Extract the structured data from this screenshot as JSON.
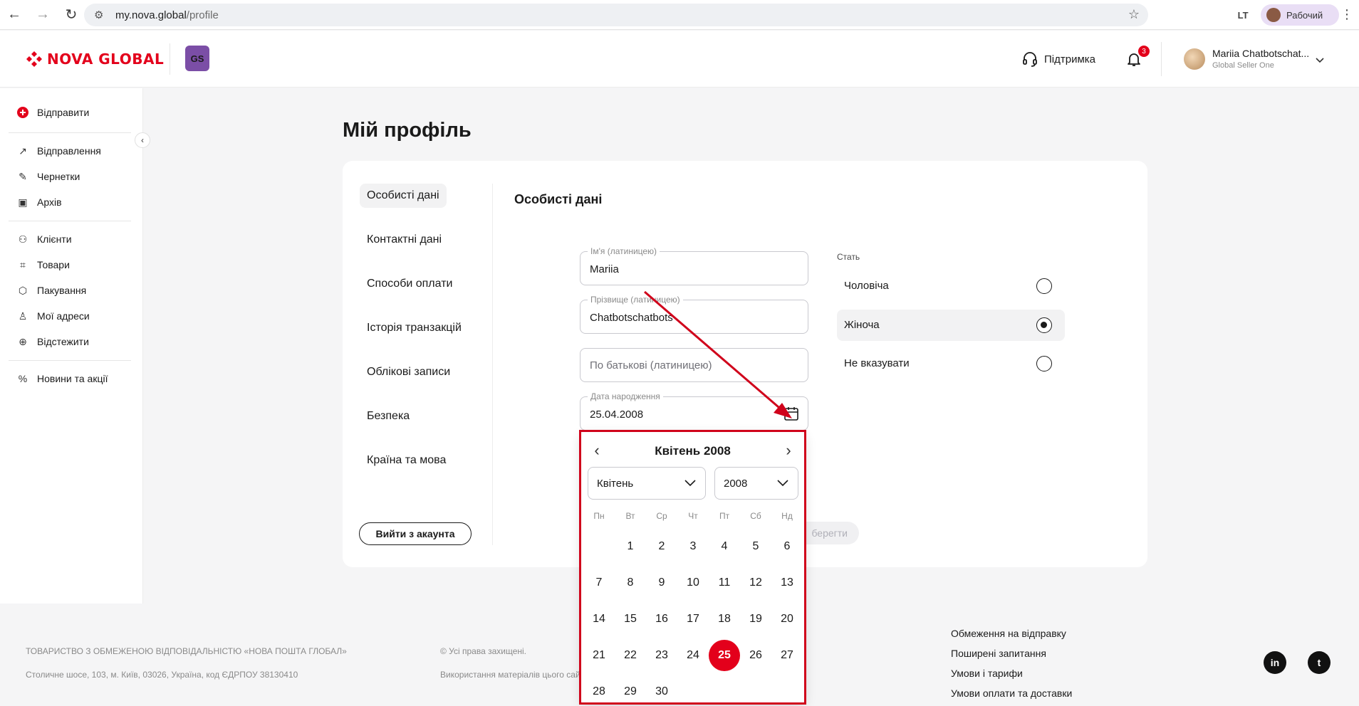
{
  "browser": {
    "url_host": "my.nova.global",
    "url_path": "/profile",
    "profile_label": "Рабочий"
  },
  "header": {
    "logo_text": "NOVA GLOBAL",
    "gs_badge": "GS",
    "support_label": "Підтримка",
    "notification_count": "3",
    "user_name": "Mariia Chatbotschat...",
    "user_org": "Global Seller One"
  },
  "sidebar": {
    "send_label": "Відправити",
    "group1": [
      "Відправлення",
      "Чернетки",
      "Архів"
    ],
    "group2": [
      "Клієнти",
      "Товари",
      "Пакування",
      "Мої адреси",
      "Відстежити"
    ],
    "group3": [
      "Новини та акції"
    ]
  },
  "main": {
    "page_title": "Мій профіль",
    "subnav": [
      "Особисті дані",
      "Контактні дані",
      "Способи оплати",
      "Історія транзакцій",
      "Облікові записи",
      "Безпека",
      "Країна та мова"
    ],
    "logout_label": "Вийти з акаунта",
    "section_title": "Особисті дані",
    "first_name": {
      "label": "Ім'я (латиницею)",
      "value": "Mariia"
    },
    "last_name": {
      "label": "Прізвище (латиницею)",
      "value": "Chatbotschatbots"
    },
    "patronymic": {
      "placeholder": "По батькові (латиницею)"
    },
    "birth_date": {
      "label": "Дата народження",
      "value": "25.04.2008"
    },
    "gender_label": "Стать",
    "gender_options": [
      "Чоловіча",
      "Жіноча",
      "Не вказувати"
    ],
    "gender_selected_index": 1,
    "save_label": "берегти"
  },
  "calendar": {
    "title": "Квітень 2008",
    "month_select": "Квітень",
    "year_select": "2008",
    "weekdays": [
      "Пн",
      "Вт",
      "Ср",
      "Чт",
      "Пт",
      "Сб",
      "Нд"
    ],
    "first_weekday_offset": 1,
    "days_in_month": 30,
    "selected_day": 25
  },
  "footer": {
    "company": "ТОВАРИСТВО З ОБМЕЖЕНОЮ ВІДПОВІДАЛЬНІСТЮ «НОВА ПОШТА ГЛОБАЛ»",
    "address": "Столичне шосе, 103, м. Київ, 03026, Україна, код ЄДРПОУ 38130410",
    "rights": "© Усі права захищені.",
    "usage": "Використання матеріалів цього сай",
    "links": [
      "Обмеження на відправку",
      "Поширені запитання",
      "Умови і тарифи",
      "Умови оплати та доставки"
    ],
    "social": [
      "in",
      "t"
    ]
  },
  "colors": {
    "brand_red": "#e3001b",
    "annotation_red": "#d0021b",
    "gs_purple": "#7b4ea6"
  }
}
